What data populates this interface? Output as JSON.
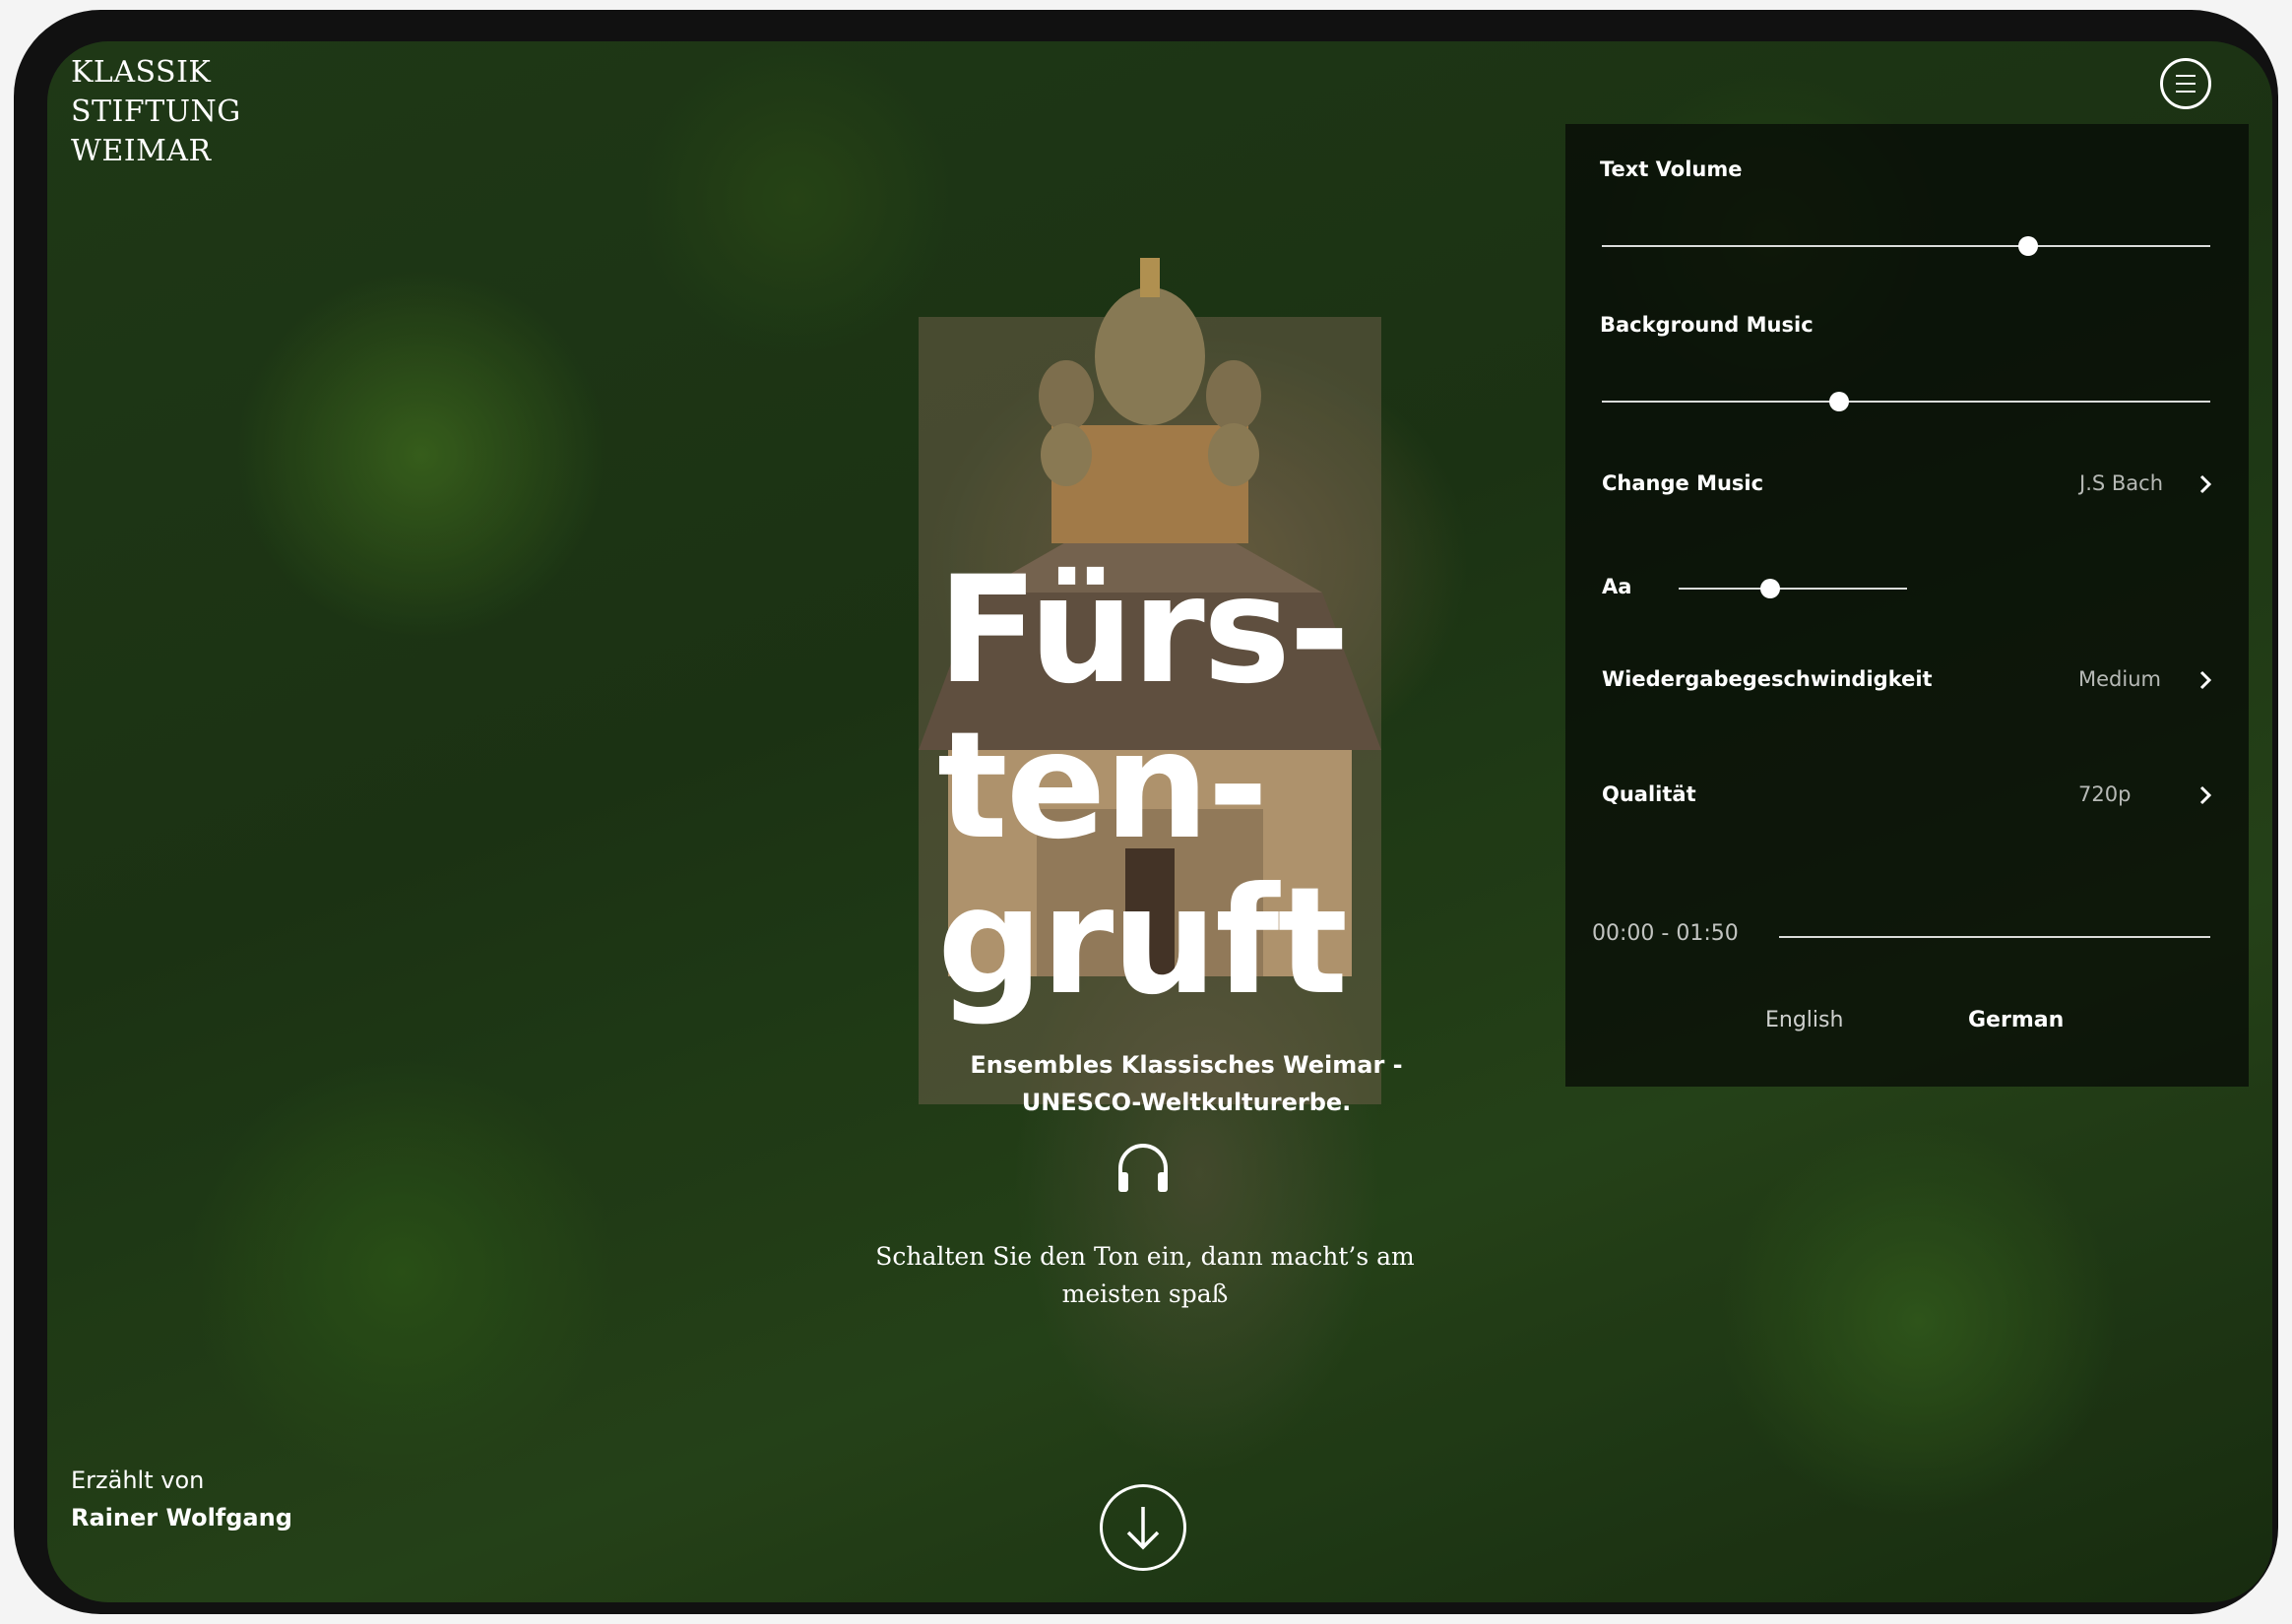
{
  "brand": {
    "logo_lines": [
      "KLASSIK",
      "STIFTUNG",
      "WEIMAR"
    ]
  },
  "hero": {
    "title_lines": [
      "Fürs-",
      "ten-",
      "gruft"
    ],
    "subtitle": "Ensembles Klassisches Weimar - UNESCO-Weltkulturerbe.",
    "hint": "Schalten Sie den Ton ein, dann macht’s am meisten spaß"
  },
  "narrator": {
    "label": "Erzählt von",
    "name": "Rainer Wolfgang"
  },
  "settings": {
    "text_volume": {
      "label": "Text Volume",
      "level": 0.7
    },
    "background_music": {
      "label": "Background Music",
      "level": 0.39
    },
    "change_music": {
      "label": "Change Music",
      "value": "J.S Bach"
    },
    "font_size": {
      "label": "Aa",
      "level": 0.4
    },
    "playback_speed": {
      "label": "Wiedergabegeschwindigkeit",
      "value": "Medium"
    },
    "quality": {
      "label": "Qualität",
      "value": "720p"
    },
    "progress": {
      "time": "00:00 - 01:50",
      "level": 0
    },
    "languages": [
      {
        "label": "English",
        "active": false
      },
      {
        "label": "German",
        "active": true
      }
    ]
  },
  "icons": {
    "menu": "menu-icon",
    "headphones": "headphones-icon",
    "scroll": "arrow-down-icon",
    "chevron": "chevron-right-icon"
  }
}
